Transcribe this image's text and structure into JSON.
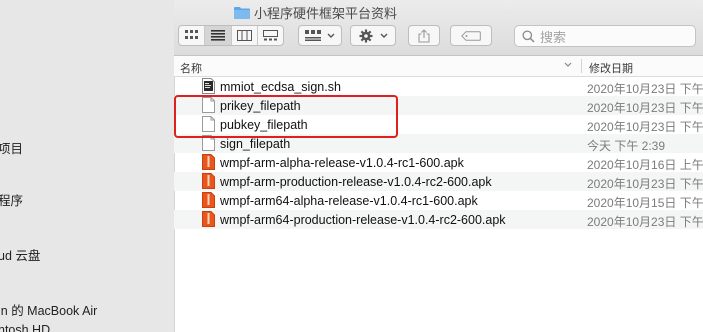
{
  "window": {
    "title": "小程序硬件框架平台资料"
  },
  "toolbar": {
    "search_placeholder": "搜索"
  },
  "sidebar": {
    "items": [
      {
        "label": "项目"
      },
      {
        "label": "程序"
      },
      {
        "label": "ud 云盘"
      },
      {
        "label": "in 的 MacBook Air"
      },
      {
        "label": "ntosh HD"
      }
    ]
  },
  "columns": {
    "name": "名称",
    "modified": "修改日期"
  },
  "files": [
    {
      "name": "mmiot_ecdsa_sign.sh",
      "date": "2020年10月23日 下午",
      "icon": "shell-script-icon"
    },
    {
      "name": "prikey_filepath",
      "date": "2020年10月23日 下午",
      "icon": "document-icon"
    },
    {
      "name": "pubkey_filepath",
      "date": "2020年10月23日 下午",
      "icon": "document-icon"
    },
    {
      "name": "sign_filepath",
      "date": "今天 下午 2:39",
      "icon": "document-icon"
    },
    {
      "name": "wmpf-arm-alpha-release-v1.0.4-rc1-600.apk",
      "date": "2020年10月16日 上午",
      "icon": "apk-icon"
    },
    {
      "name": "wmpf-arm-production-release-v1.0.4-rc2-600.apk",
      "date": "2020年10月23日 下午",
      "icon": "apk-icon"
    },
    {
      "name": "wmpf-arm64-alpha-release-v1.0.4-rc1-600.apk",
      "date": "2020年10月15日 下午",
      "icon": "apk-icon"
    },
    {
      "name": "wmpf-arm64-production-release-v1.0.4-rc2-600.apk",
      "date": "2020年10月23日 下午",
      "icon": "apk-icon"
    }
  ],
  "colors": {
    "highlight": "#e0201c",
    "apk": "#e8561c",
    "folder": "#5fa8e6"
  }
}
